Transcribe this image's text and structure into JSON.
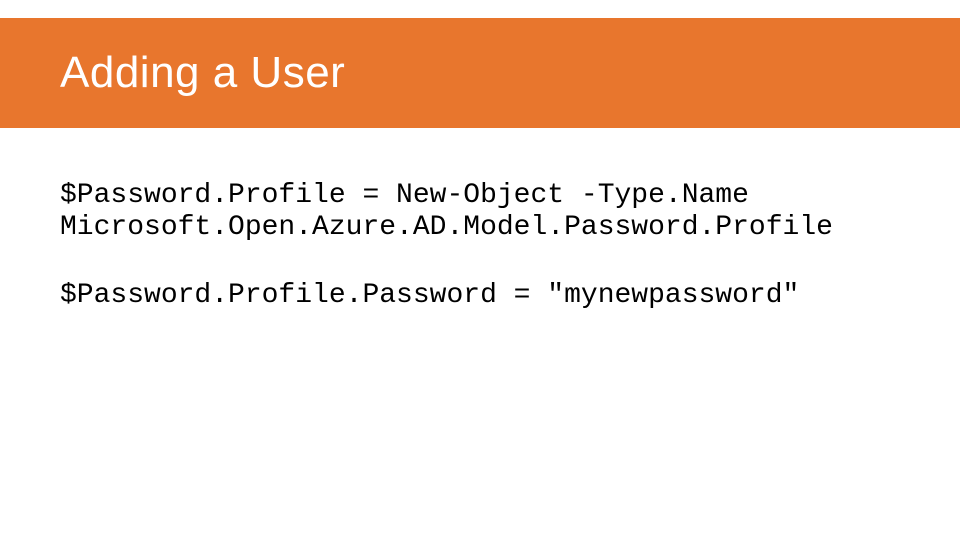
{
  "slide": {
    "title": "Adding a User",
    "code_lines": {
      "line1": "$Password.Profile = New-Object -Type.Name Microsoft.Open.Azure.AD.Model.Password.Profile",
      "line2": "$Password.Profile.Password = \"mynewpassword\""
    }
  }
}
